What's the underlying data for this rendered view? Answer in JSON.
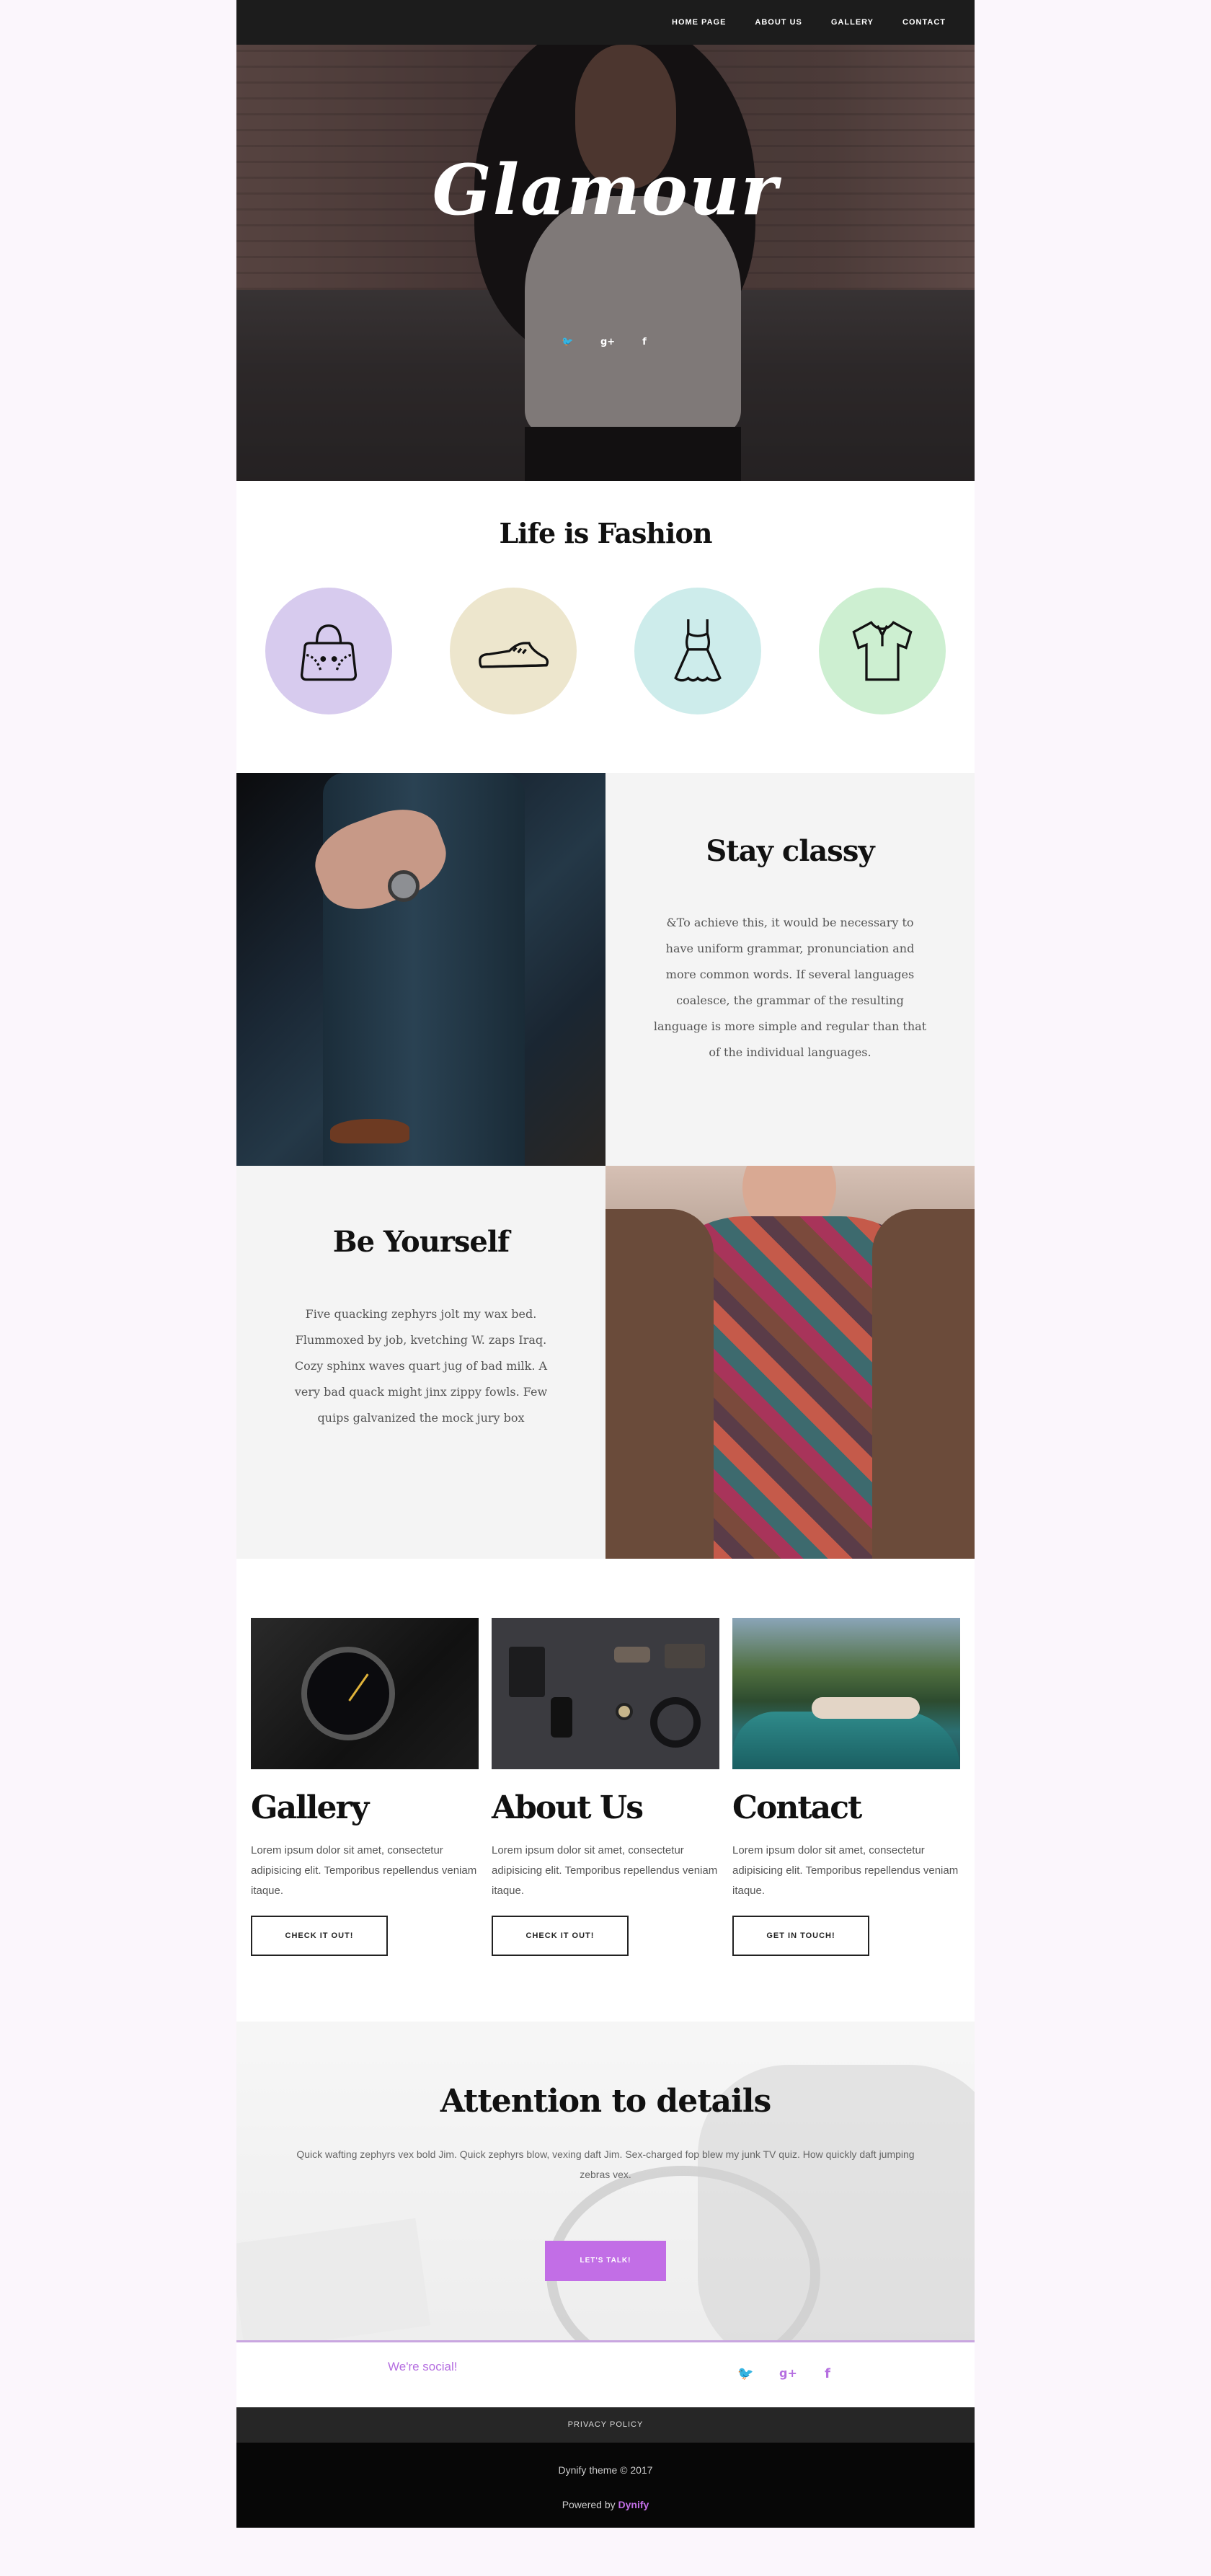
{
  "nav": {
    "links": [
      "HOME PAGE",
      "ABOUT US",
      "GALLERY",
      "CONTACT"
    ]
  },
  "hero": {
    "title": "Glamour",
    "social_icons": [
      "twitter-icon",
      "google-plus-icon",
      "facebook-icon"
    ]
  },
  "fashion": {
    "title": "Life is Fashion",
    "icons": [
      {
        "name": "handbag-icon",
        "color": "#d7cbee"
      },
      {
        "name": "shoe-icon",
        "color": "#ede6cd"
      },
      {
        "name": "dress-icon",
        "color": "#cdeceb"
      },
      {
        "name": "shirt-icon",
        "color": "#cdefd1"
      }
    ]
  },
  "stay_classy": {
    "title": "Stay classy",
    "text": "&To achieve this, it would be necessary to have uniform grammar, pronunciation and more common words. If several languages coalesce, the grammar of the resulting language is more simple and regular than that of the individual languages."
  },
  "be_yourself": {
    "title": "Be Yourself",
    "text": "Five quacking zephyrs jolt my wax bed. Flummoxed by job, kvetching W. zaps Iraq. Cozy sphinx waves quart jug of bad milk. A very bad quack might jinx zippy fowls. Few quips galvanized the mock jury box"
  },
  "cards": [
    {
      "title": "Gallery",
      "text": "Lorem ipsum dolor sit amet, consectetur adipisicing elit. Temporibus repellendus veniam itaque.",
      "button": "CHECK IT OUT!"
    },
    {
      "title": "About Us",
      "text": "Lorem ipsum dolor sit amet, consectetur adipisicing elit. Temporibus repellendus veniam itaque.",
      "button": "CHECK IT OUT!"
    },
    {
      "title": "Contact",
      "text": "Lorem ipsum dolor sit amet, consectetur adipisicing elit. Temporibus repellendus veniam itaque.",
      "button": "GET IN TOUCH!"
    }
  ],
  "attention": {
    "title": "Attention to details",
    "text": "Quick wafting zephyrs vex bold Jim. Quick zephyrs blow, vexing daft Jim. Sex-charged fop blew my junk TV quiz. How quickly daft jumping zebras vex.",
    "button": "LET'S TALK!"
  },
  "social": {
    "label": "We're social!",
    "icons": [
      "twitter-icon",
      "google-plus-icon",
      "facebook-icon"
    ],
    "accent": "#b56ee0"
  },
  "footer": {
    "policy": "PRIVACY POLICY",
    "copyright": "Dynify theme © 2017",
    "powered_prefix": "Powered by",
    "powered_brand": "Dynify"
  }
}
